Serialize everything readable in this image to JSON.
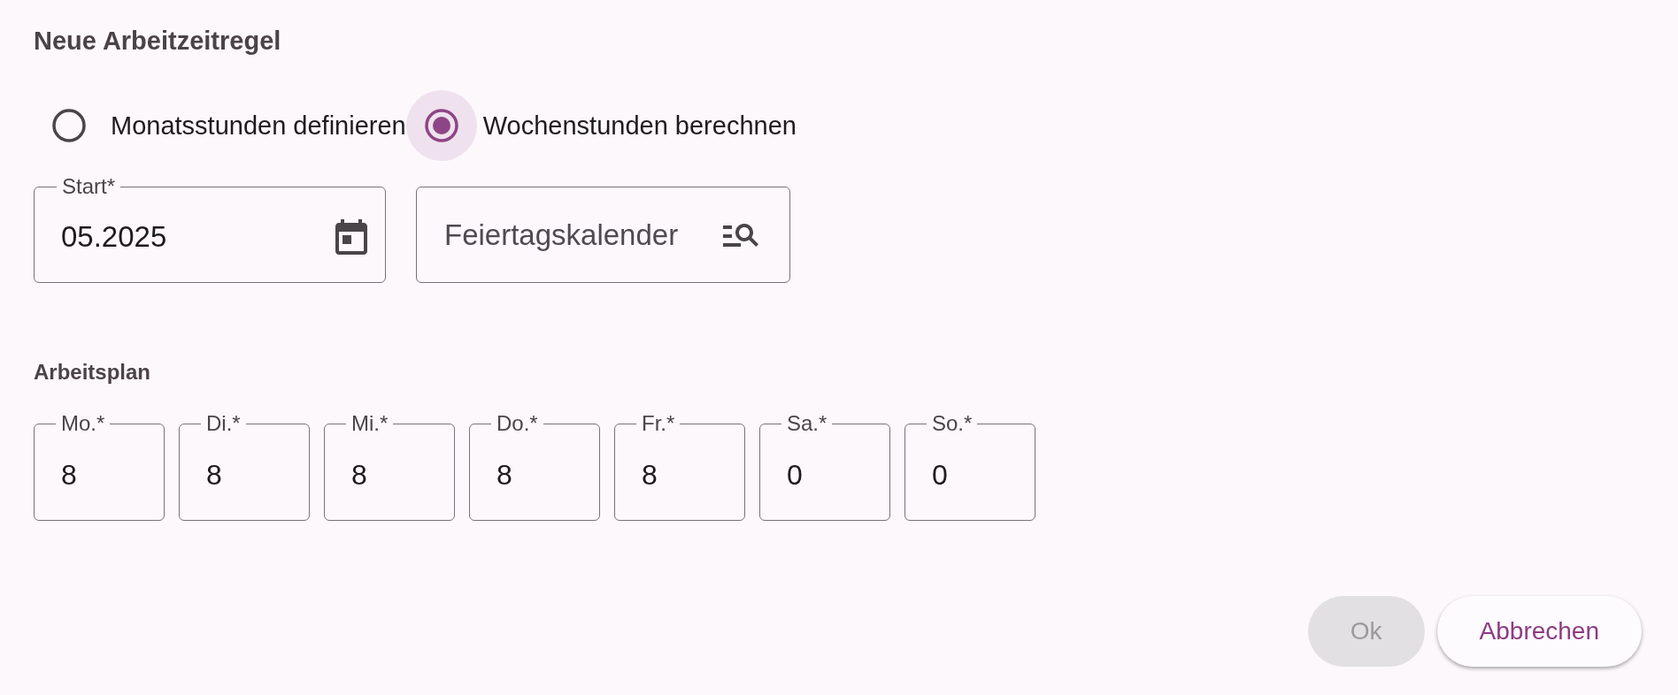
{
  "dialog": {
    "title": "Neue Arbeitzeitregel"
  },
  "mode_options": [
    {
      "label": "Monatsstunden definieren",
      "selected": false,
      "focused": false
    },
    {
      "label": "Wochenstunden berechnen",
      "selected": true,
      "focused": true
    }
  ],
  "fields": [
    {
      "kind": "date",
      "label": "Start*",
      "value": "05.2025"
    },
    {
      "kind": "lookup",
      "placeholder": "Feiertagskalender"
    }
  ],
  "work_plan": {
    "title": "Arbeitsplan",
    "days": [
      {
        "label": "Mo.*",
        "value": "8"
      },
      {
        "label": "Di.*",
        "value": "8"
      },
      {
        "label": "Mi.*",
        "value": "8"
      },
      {
        "label": "Do.*",
        "value": "8"
      },
      {
        "label": "Fr.*",
        "value": "8"
      },
      {
        "label": "Sa.*",
        "value": "0"
      },
      {
        "label": "So.*",
        "value": "0"
      }
    ]
  },
  "buttons": [
    {
      "label": "Ok",
      "disabled": true
    },
    {
      "label": "Abbrechen",
      "disabled": false
    }
  ]
}
